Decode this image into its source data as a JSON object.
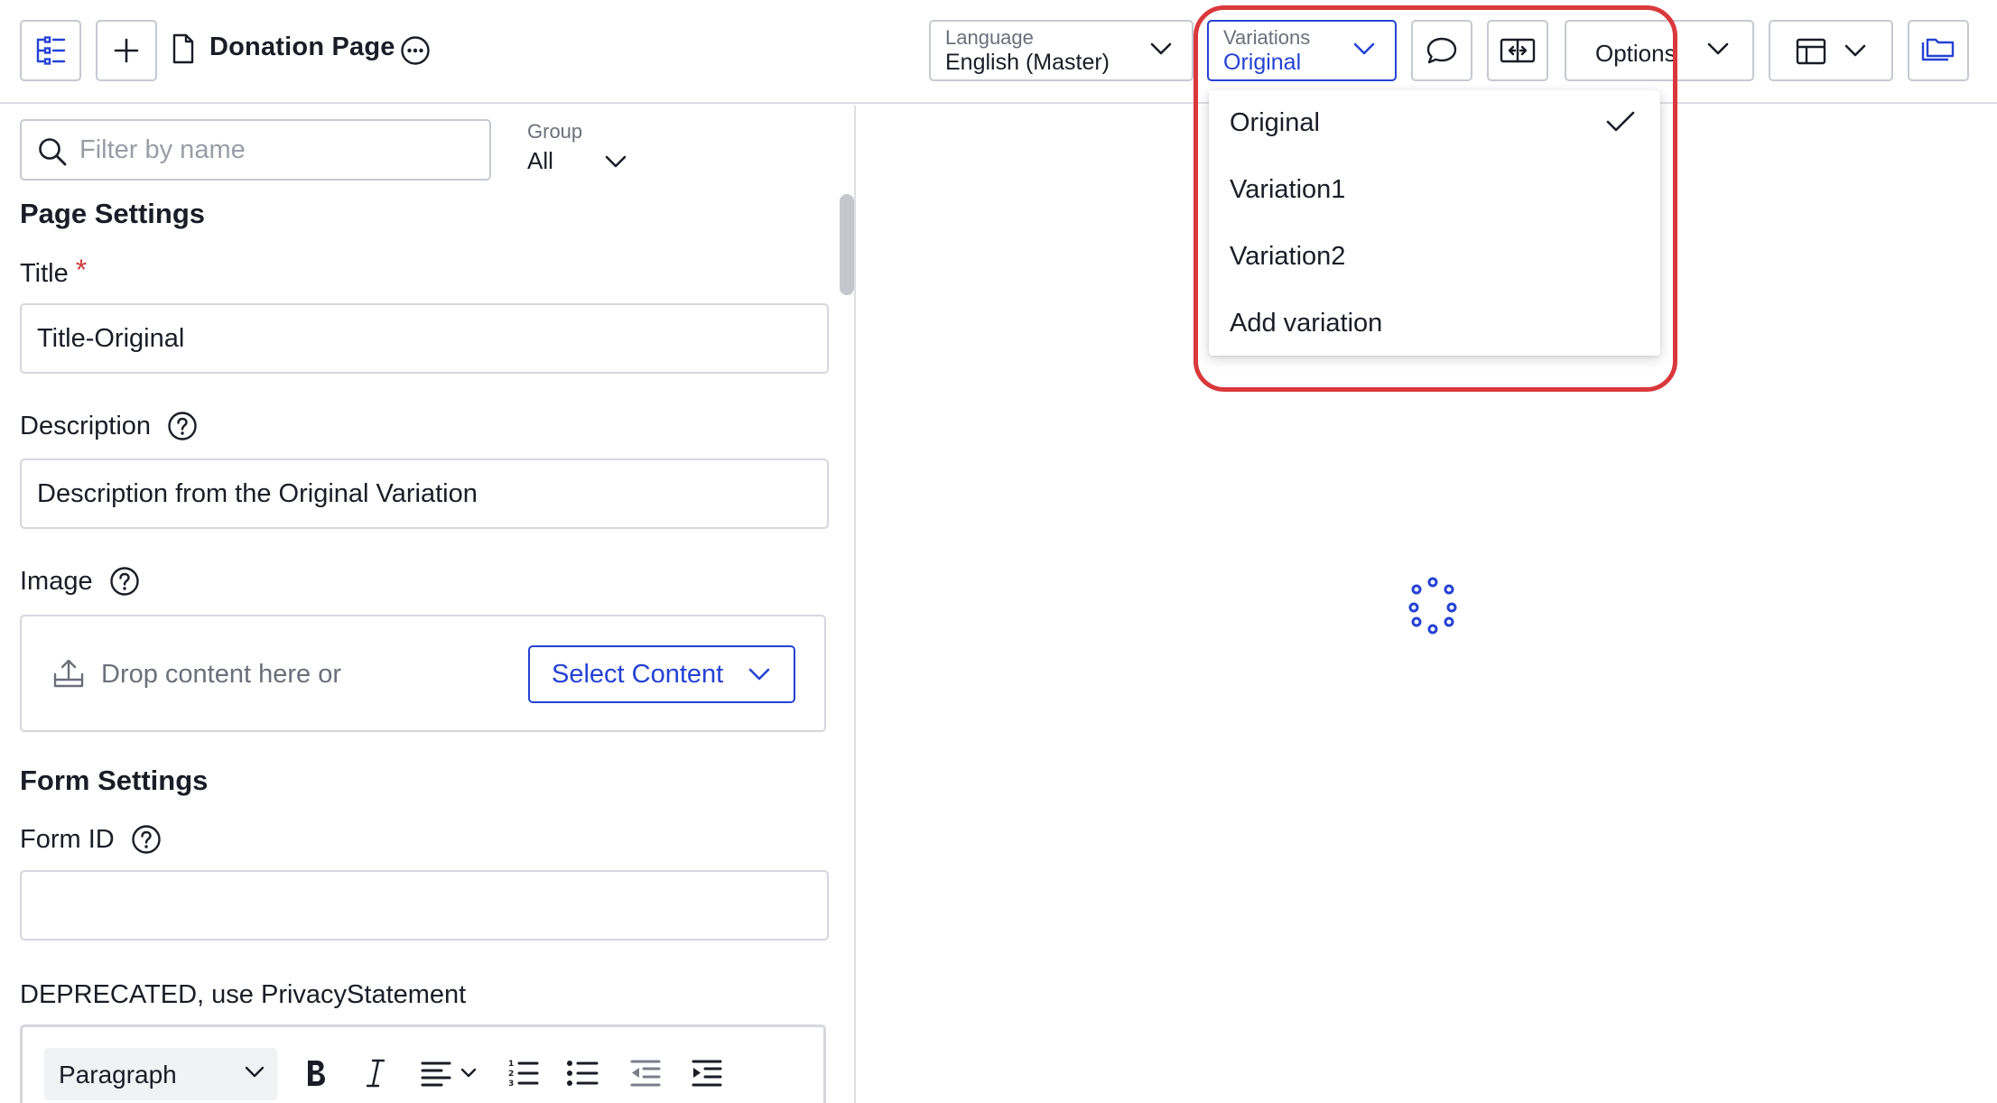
{
  "header": {
    "title": "Donation Page",
    "language": {
      "label": "Language",
      "value": "English (Master)"
    },
    "variations": {
      "label": "Variations",
      "value": "Original"
    },
    "options_label": "Options"
  },
  "filter": {
    "placeholder": "Filter by name"
  },
  "group": {
    "label": "Group",
    "value": "All"
  },
  "page_settings": {
    "heading": "Page Settings",
    "title_label": "Title",
    "required_mark": "*",
    "title_value": "Title-Original",
    "description_label": "Description",
    "description_value": "Description from the Original Variation",
    "image_label": "Image",
    "drop_text": "Drop content here or",
    "select_content_label": "Select Content"
  },
  "form_settings": {
    "heading": "Form Settings",
    "form_id_label": "Form ID",
    "form_id_value": "",
    "deprecated_label": "DEPRECATED, use PrivacyStatement",
    "paragraph_select": "Paragraph"
  },
  "variations_menu": {
    "items": [
      {
        "label": "Original",
        "selected": true
      },
      {
        "label": "Variation1",
        "selected": false
      },
      {
        "label": "Variation2",
        "selected": false
      },
      {
        "label": "Add variation",
        "selected": false
      }
    ]
  },
  "colors": {
    "accent": "#2442d4",
    "highlight": "#d9393c",
    "required": "#d23a3a",
    "border": "#c6c9d1"
  }
}
